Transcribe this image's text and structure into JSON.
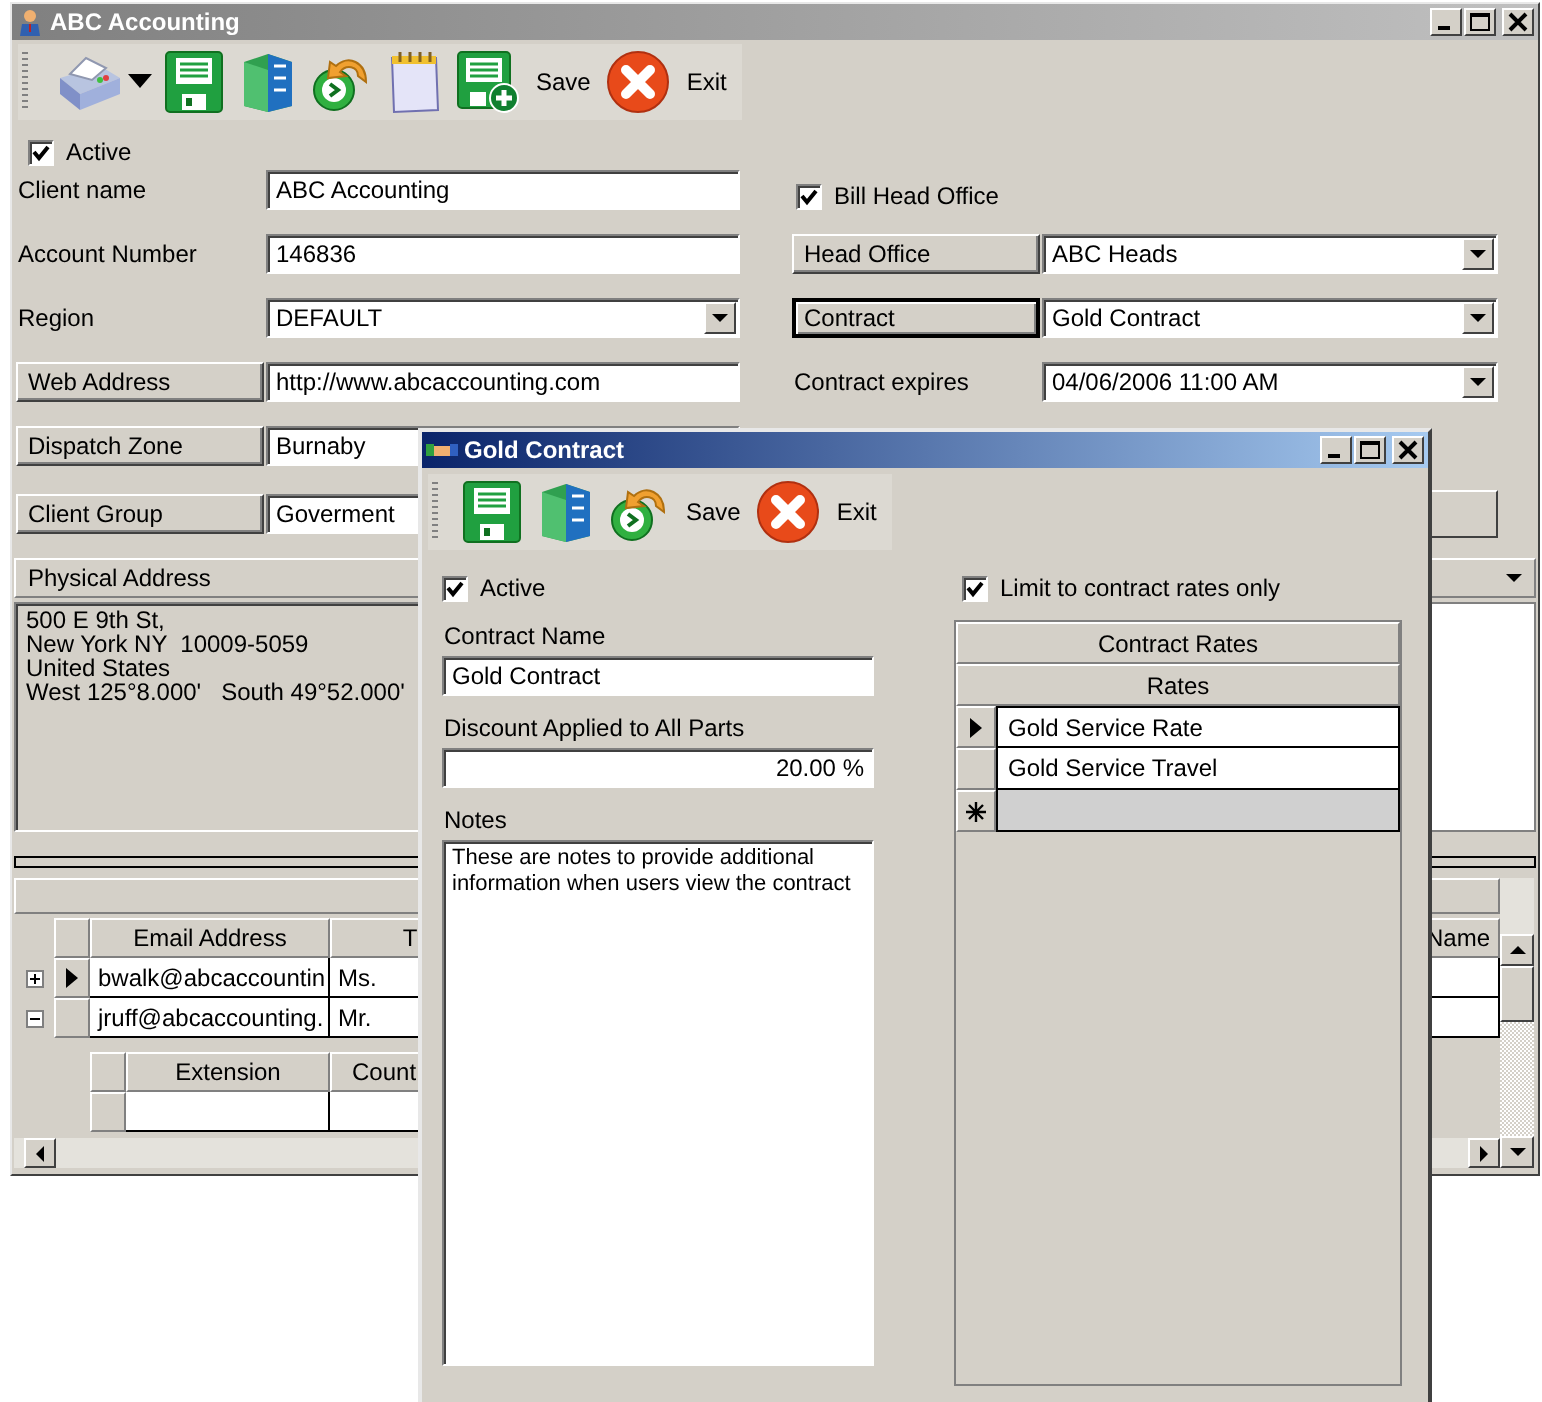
{
  "main_window": {
    "title": "ABC Accounting",
    "toolbar": [
      "Save",
      "Exit"
    ],
    "active": {
      "label": "Active",
      "checked": true
    },
    "left_fields": [
      {
        "kind": "label",
        "label": "Client name",
        "value": "ABC Accounting",
        "dropdown": false
      },
      {
        "kind": "label",
        "label": "Account Number",
        "value": "146836",
        "dropdown": false
      },
      {
        "kind": "label",
        "label": "Region",
        "value": "DEFAULT",
        "dropdown": true
      },
      {
        "kind": "button",
        "label": "Web Address",
        "value": "http://www.abcaccounting.com",
        "dropdown": false
      },
      {
        "kind": "button",
        "label": "Dispatch Zone",
        "value": "Burnaby"
      },
      {
        "kind": "button",
        "label": "Client Group",
        "value": "Goverment"
      }
    ],
    "bill_head_office": {
      "label": "Bill Head Office",
      "checked": true
    },
    "right_fields": [
      {
        "kind": "button",
        "label": "Head Office",
        "value": "ABC Heads",
        "focused": false
      },
      {
        "kind": "button",
        "label": "Contract",
        "value": "Gold Contract",
        "focused": true
      },
      {
        "kind": "label",
        "label": "Contract expires",
        "value": "04/06/2006 11:00 AM",
        "focused": false
      }
    ],
    "address": {
      "label": "Physical Address",
      "text": "500 E 9th St,\nNew York NY  10009-5059\nUnited States\nWest 125°8.000'   South 49°52.000'"
    },
    "contacts": {
      "columns": [
        "Email Address",
        "T",
        "Name"
      ],
      "rows": [
        {
          "expanded": false,
          "selected": true,
          "cells": [
            "bwalk@abcaccountin",
            "Ms."
          ]
        },
        {
          "expanded": true,
          "selected": false,
          "cells": [
            "jruff@abcaccounting.",
            "Mr."
          ]
        }
      ],
      "child_columns": [
        "Extension",
        "Count"
      ]
    }
  },
  "dialog": {
    "title": "Gold Contract",
    "toolbar": [
      "Save",
      "Exit"
    ],
    "active": {
      "label": "Active",
      "checked": true
    },
    "contract_name": {
      "label": "Contract Name",
      "value": "Gold Contract"
    },
    "discount": {
      "label": "Discount Applied to All Parts",
      "value": "20.00 %"
    },
    "notes": {
      "label": "Notes",
      "value": "These are notes to provide additional information when users view the contract"
    },
    "limit_rates": {
      "label": "Limit to contract rates only",
      "checked": true
    },
    "rates": {
      "title": "Contract Rates",
      "column": "Rates",
      "rows": [
        {
          "text": "Gold Service Rate",
          "selected": true
        },
        {
          "text": "Gold Service Travel",
          "selected": false
        }
      ]
    }
  }
}
